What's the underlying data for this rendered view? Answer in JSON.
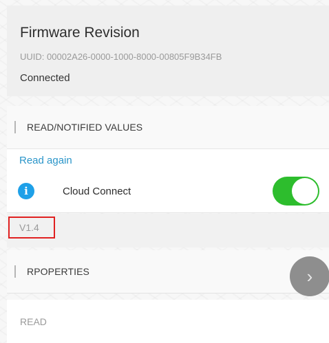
{
  "header": {
    "title": "Firmware Revision",
    "uuid": "UUID: 00002A26-0000-1000-8000-00805F9B34FB",
    "status": "Connected"
  },
  "values_section": {
    "heading": "READ/NOTIFIED VALUES",
    "read_again": "Read again",
    "info_icon": "info-icon",
    "item_label": "Cloud Connect",
    "toggle_state": "on",
    "value": "V1.4"
  },
  "properties_section": {
    "heading": "RPOPERTIES",
    "chevron_icon": "chevron-right-icon",
    "items": [
      "READ"
    ]
  },
  "colors": {
    "accent_link": "#2a95c9",
    "toggle_on": "#2dbd2d",
    "info": "#1ea0e8",
    "highlight": "#e02020"
  }
}
